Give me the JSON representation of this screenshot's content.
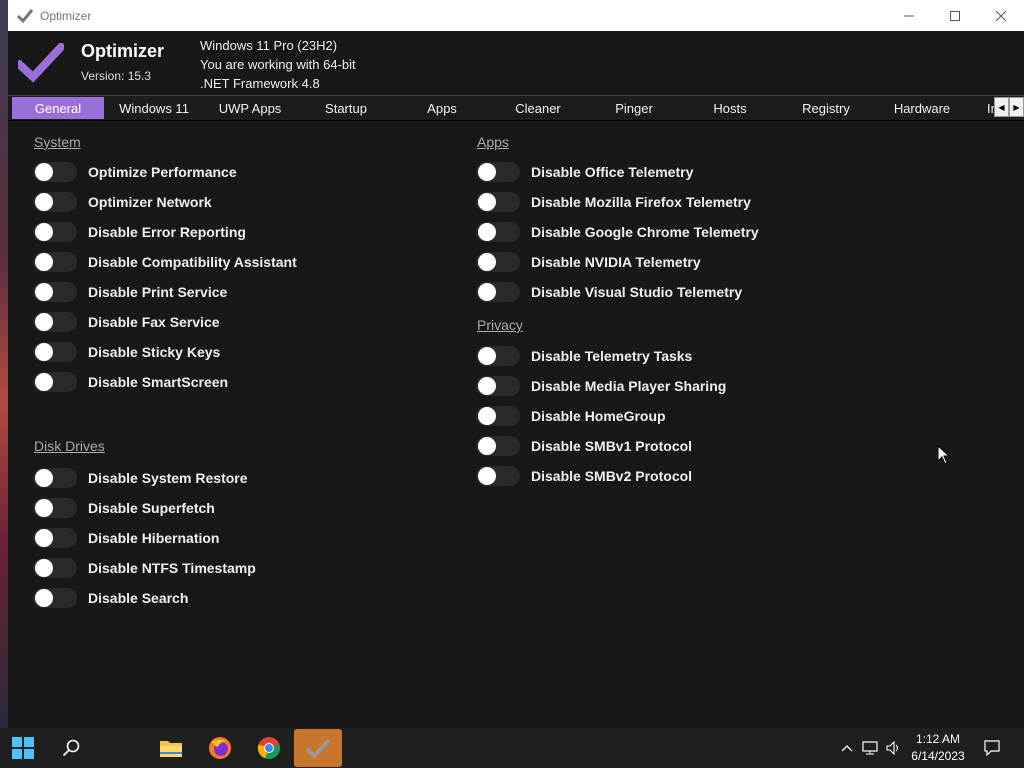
{
  "window": {
    "title": "Optimizer"
  },
  "header": {
    "brand": "Optimizer",
    "version": "Version: 15.3",
    "sysinfo": [
      "Windows 11 Pro (23H2)",
      "You are working with 64-bit",
      ".NET Framework 4.8"
    ]
  },
  "tabs": [
    "General",
    "Windows 11",
    "UWP Apps",
    "Startup",
    "Apps",
    "Cleaner",
    "Pinger",
    "Hosts",
    "Registry",
    "Hardware",
    "In"
  ],
  "active_tab": "General",
  "sections": {
    "system": {
      "title": "System",
      "items": [
        "Optimize Performance",
        "Optimizer Network",
        "Disable Error Reporting",
        "Disable Compatibility Assistant",
        "Disable Print Service",
        "Disable Fax Service",
        "Disable Sticky Keys",
        "Disable SmartScreen"
      ]
    },
    "disk": {
      "title": "Disk Drives",
      "items": [
        "Disable System Restore",
        "Disable Superfetch",
        "Disable Hibernation",
        "Disable NTFS Timestamp",
        "Disable Search"
      ]
    },
    "apps": {
      "title": "Apps",
      "items": [
        "Disable Office Telemetry",
        "Disable Mozilla Firefox Telemetry",
        "Disable Google Chrome Telemetry",
        "Disable NVIDIA Telemetry",
        "Disable Visual Studio Telemetry"
      ]
    },
    "privacy": {
      "title": "Privacy",
      "items": [
        "Disable Telemetry Tasks",
        "Disable Media Player Sharing",
        "Disable HomeGroup",
        "Disable SMBv1 Protocol",
        "Disable SMBv2 Protocol"
      ]
    }
  },
  "taskbar": {
    "apps": [
      "start-icon",
      "search-icon",
      "file-explorer-icon",
      "firefox-icon",
      "chrome-icon",
      "optimizer-icon"
    ],
    "time": "1:12 AM",
    "date": "6/14/2023"
  },
  "colors": {
    "accent": "#9b6fd9",
    "background": "#181818",
    "active_app": "#c8752d"
  }
}
